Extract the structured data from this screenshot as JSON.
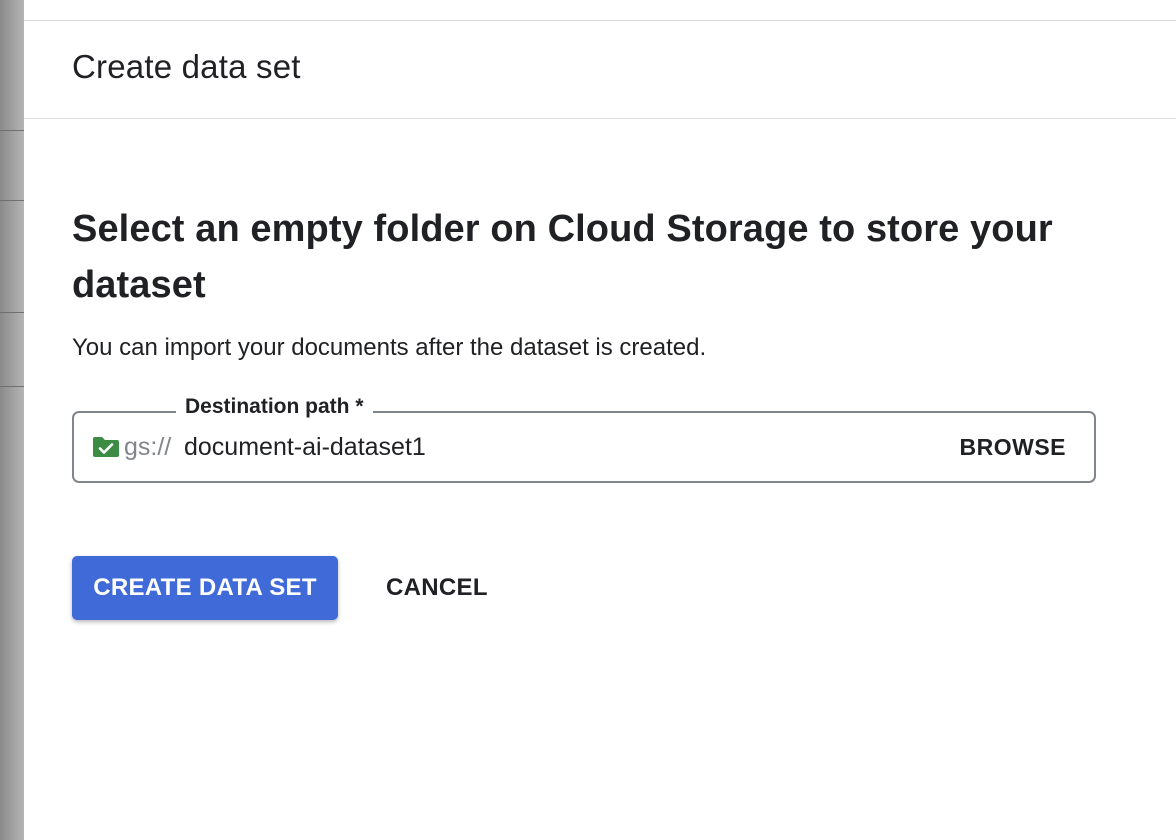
{
  "panel": {
    "title": "Create data set"
  },
  "main": {
    "heading": "Select an empty folder on Cloud Storage to store your dataset",
    "subtext": "You can import your documents after the dataset is created."
  },
  "destination": {
    "label": "Destination path *",
    "prefix": "gs://",
    "value": "document-ai-dataset1",
    "status_icon": "folder-check-icon",
    "status_color": "#3c8c43",
    "browse_label": "BROWSE"
  },
  "actions": {
    "create_label": "CREATE DATA SET",
    "cancel_label": "CANCEL",
    "primary_color": "#3f6ad8"
  }
}
